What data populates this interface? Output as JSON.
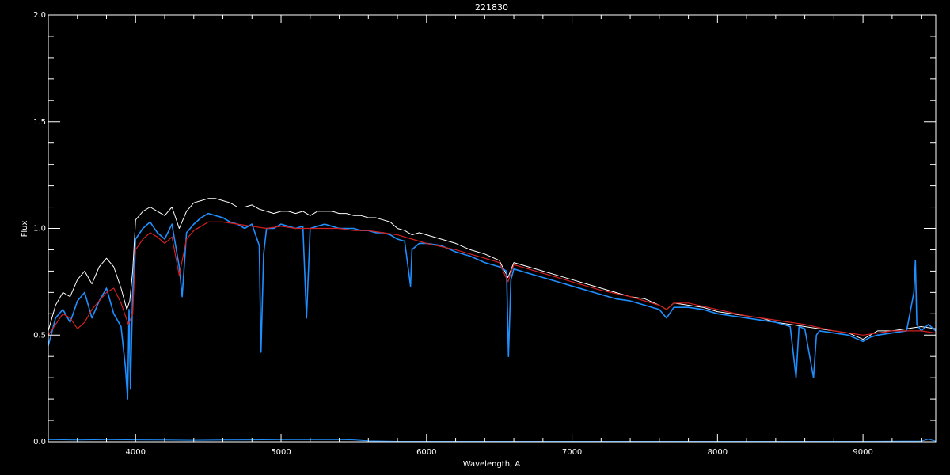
{
  "chart_data": {
    "type": "line",
    "title": "221830",
    "xlabel": "Wavelength, A",
    "ylabel": "Flux",
    "xlim": [
      3400,
      9500
    ],
    "ylim": [
      0.0,
      2.0
    ],
    "x_ticks": [
      4000,
      5000,
      6000,
      7000,
      8000,
      9000
    ],
    "x_tick_labels": [
      "4000",
      "5000",
      "6000",
      "7000",
      "8000",
      "9000"
    ],
    "x_minor_step": 200,
    "y_ticks": [
      0.0,
      0.5,
      1.0,
      1.5,
      2.0
    ],
    "y_tick_labels": [
      "0.0",
      "0.5",
      "1.0",
      "1.5",
      "2.0"
    ],
    "y_minor_step": 0.1,
    "grid": false,
    "colors": {
      "background": "#000000",
      "axes": "#ffffff",
      "observed": "#ffffff",
      "spectrum": "#1e8fff",
      "model": "#d42020",
      "error": "#1e8fff"
    },
    "series": [
      {
        "role": "observed",
        "x": [
          3400,
          3450,
          3500,
          3550,
          3600,
          3650,
          3700,
          3750,
          3800,
          3850,
          3900,
          3940,
          3960,
          3980,
          4000,
          4050,
          4100,
          4150,
          4200,
          4250,
          4300,
          4350,
          4400,
          4450,
          4500,
          4550,
          4600,
          4650,
          4700,
          4750,
          4800,
          4850,
          4900,
          4950,
          5000,
          5050,
          5100,
          5150,
          5200,
          5250,
          5300,
          5350,
          5400,
          5450,
          5500,
          5550,
          5600,
          5650,
          5700,
          5750,
          5800,
          5850,
          5900,
          5950,
          6000,
          6100,
          6200,
          6300,
          6400,
          6500,
          6560,
          6600,
          6700,
          6800,
          6900,
          7000,
          7100,
          7200,
          7300,
          7400,
          7500,
          7600,
          7650,
          7700,
          7800,
          7900,
          8000,
          8100,
          8200,
          8300,
          8400,
          8500,
          8600,
          8700,
          8800,
          8900,
          9000,
          9100,
          9200,
          9300,
          9400,
          9500
        ],
        "y": [
          0.52,
          0.64,
          0.7,
          0.68,
          0.76,
          0.8,
          0.74,
          0.82,
          0.86,
          0.82,
          0.72,
          0.62,
          0.66,
          0.8,
          1.04,
          1.08,
          1.1,
          1.08,
          1.06,
          1.1,
          1.0,
          1.08,
          1.12,
          1.13,
          1.14,
          1.14,
          1.13,
          1.12,
          1.1,
          1.1,
          1.11,
          1.09,
          1.08,
          1.07,
          1.08,
          1.08,
          1.07,
          1.08,
          1.06,
          1.08,
          1.08,
          1.08,
          1.07,
          1.07,
          1.06,
          1.06,
          1.05,
          1.05,
          1.04,
          1.03,
          1.0,
          0.99,
          0.97,
          0.98,
          0.97,
          0.95,
          0.93,
          0.9,
          0.88,
          0.85,
          0.77,
          0.84,
          0.82,
          0.8,
          0.78,
          0.76,
          0.74,
          0.72,
          0.7,
          0.68,
          0.67,
          0.64,
          0.62,
          0.65,
          0.64,
          0.63,
          0.61,
          0.6,
          0.59,
          0.58,
          0.56,
          0.55,
          0.54,
          0.53,
          0.52,
          0.51,
          0.48,
          0.52,
          0.52,
          0.53,
          0.54,
          0.53
        ]
      },
      {
        "role": "spectrum",
        "x": [
          3400,
          3450,
          3500,
          3550,
          3600,
          3650,
          3700,
          3750,
          3800,
          3850,
          3900,
          3930,
          3945,
          3955,
          3965,
          3980,
          4000,
          4050,
          4100,
          4150,
          4200,
          4250,
          4300,
          4320,
          4350,
          4400,
          4450,
          4500,
          4550,
          4600,
          4650,
          4700,
          4750,
          4800,
          4850,
          4862,
          4880,
          4900,
          4950,
          5000,
          5050,
          5100,
          5150,
          5175,
          5200,
          5250,
          5300,
          5350,
          5400,
          5450,
          5500,
          5550,
          5600,
          5650,
          5700,
          5750,
          5800,
          5850,
          5890,
          5900,
          5950,
          6000,
          6100,
          6200,
          6300,
          6400,
          6500,
          6550,
          6563,
          6580,
          6600,
          6700,
          6800,
          6900,
          7000,
          7100,
          7200,
          7300,
          7400,
          7500,
          7600,
          7650,
          7700,
          7800,
          7900,
          8000,
          8100,
          8200,
          8300,
          8400,
          8500,
          8540,
          8560,
          8600,
          8660,
          8680,
          8700,
          8800,
          8900,
          9000,
          9050,
          9100,
          9200,
          9300,
          9350,
          9360,
          9370,
          9400,
          9450,
          9500
        ],
        "y": [
          0.45,
          0.58,
          0.62,
          0.56,
          0.66,
          0.7,
          0.58,
          0.66,
          0.72,
          0.6,
          0.54,
          0.35,
          0.2,
          0.62,
          0.25,
          0.7,
          0.95,
          1.0,
          1.03,
          0.98,
          0.95,
          1.02,
          0.82,
          0.68,
          0.98,
          1.02,
          1.05,
          1.07,
          1.06,
          1.05,
          1.03,
          1.02,
          1.0,
          1.02,
          0.92,
          0.42,
          0.88,
          1.0,
          1.0,
          1.02,
          1.01,
          1.0,
          1.01,
          0.58,
          1.0,
          1.01,
          1.02,
          1.01,
          1.0,
          1.0,
          1.0,
          0.99,
          0.99,
          0.98,
          0.98,
          0.97,
          0.95,
          0.94,
          0.73,
          0.9,
          0.93,
          0.93,
          0.92,
          0.89,
          0.87,
          0.84,
          0.82,
          0.8,
          0.4,
          0.76,
          0.81,
          0.79,
          0.77,
          0.75,
          0.73,
          0.71,
          0.69,
          0.67,
          0.66,
          0.64,
          0.62,
          0.58,
          0.63,
          0.63,
          0.62,
          0.6,
          0.59,
          0.58,
          0.57,
          0.56,
          0.54,
          0.3,
          0.54,
          0.53,
          0.3,
          0.5,
          0.52,
          0.51,
          0.5,
          0.47,
          0.49,
          0.5,
          0.51,
          0.52,
          0.7,
          0.85,
          0.55,
          0.52,
          0.55,
          0.52
        ]
      },
      {
        "role": "model",
        "x": [
          3400,
          3450,
          3500,
          3550,
          3600,
          3650,
          3700,
          3750,
          3800,
          3850,
          3900,
          3950,
          3980,
          4000,
          4050,
          4100,
          4150,
          4200,
          4250,
          4300,
          4350,
          4400,
          4450,
          4500,
          4600,
          4700,
          4800,
          4900,
          5000,
          5100,
          5200,
          5300,
          5400,
          5500,
          5600,
          5700,
          5800,
          5900,
          6000,
          6200,
          6400,
          6500,
          6560,
          6600,
          6800,
          7000,
          7200,
          7400,
          7600,
          7650,
          7700,
          7800,
          8000,
          8200,
          8400,
          8600,
          8800,
          9000,
          9100,
          9200,
          9300,
          9400,
          9500
        ],
        "y": [
          0.5,
          0.55,
          0.6,
          0.58,
          0.53,
          0.56,
          0.62,
          0.66,
          0.7,
          0.72,
          0.65,
          0.55,
          0.6,
          0.9,
          0.95,
          0.98,
          0.96,
          0.93,
          0.96,
          0.78,
          0.95,
          0.99,
          1.01,
          1.03,
          1.03,
          1.02,
          1.01,
          1.0,
          1.01,
          1.0,
          1.0,
          1.0,
          1.0,
          0.99,
          0.99,
          0.98,
          0.97,
          0.95,
          0.93,
          0.9,
          0.86,
          0.84,
          0.75,
          0.83,
          0.79,
          0.75,
          0.71,
          0.68,
          0.64,
          0.62,
          0.65,
          0.65,
          0.62,
          0.59,
          0.57,
          0.55,
          0.52,
          0.5,
          0.51,
          0.52,
          0.52,
          0.52,
          0.51
        ]
      },
      {
        "role": "error",
        "x": [
          3400,
          3600,
          3800,
          4000,
          4200,
          4400,
          4600,
          4800,
          5000,
          5200,
          5400,
          5500,
          5600,
          5800,
          6000,
          7000,
          8000,
          9000,
          9400,
          9450,
          9500
        ],
        "y": [
          0.01,
          0.008,
          0.01,
          0.009,
          0.008,
          0.007,
          0.008,
          0.009,
          0.01,
          0.01,
          0.01,
          0.009,
          0.004,
          0.002,
          0.002,
          0.002,
          0.002,
          0.002,
          0.003,
          0.012,
          0.003
        ]
      }
    ]
  }
}
